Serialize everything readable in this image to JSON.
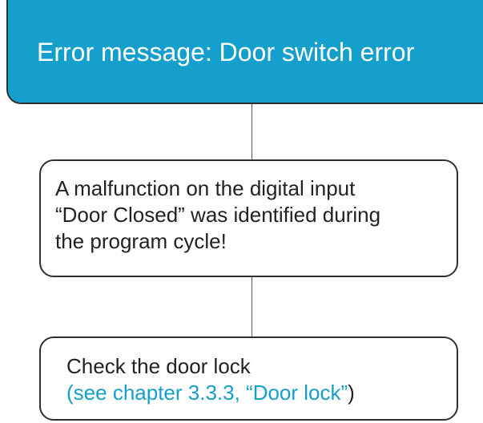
{
  "header": {
    "title": "Error message: Door switch error"
  },
  "steps": [
    {
      "lines": [
        "A malfunction on the digital input",
        "“Door Closed” was identified during",
        "the program cycle!"
      ]
    },
    {
      "line1": "Check the door lock",
      "open_paren": "(",
      "link_text": "see chapter 3.3.3, “Door lock”",
      "close_paren": ")"
    }
  ],
  "colors": {
    "header_fill": "#149fcc",
    "link": "#149fcc",
    "border": "#2f2f2f"
  }
}
